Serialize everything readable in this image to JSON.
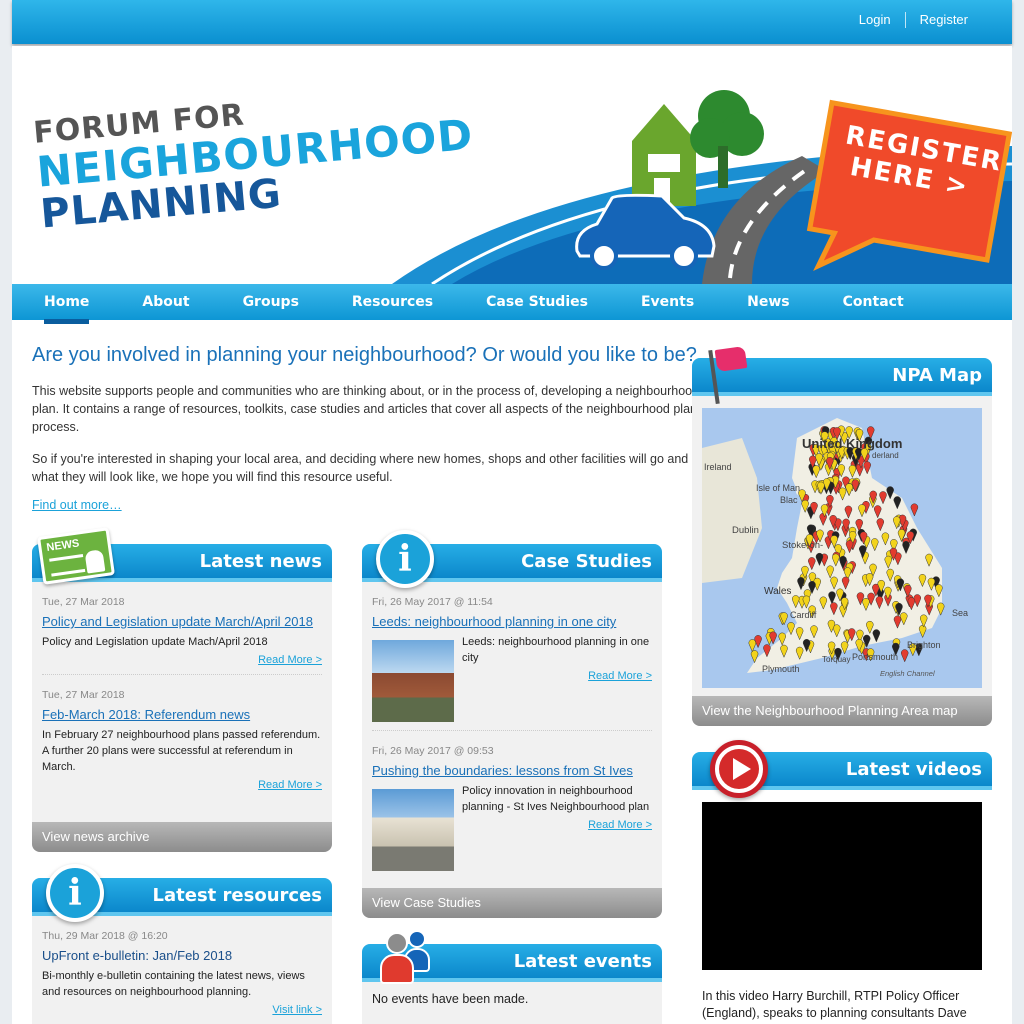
{
  "topbar": {
    "login": "Login",
    "register": "Register"
  },
  "logo": {
    "line1": "FORUM FOR",
    "line2": "NEIGHBOURHOOD",
    "line3": "PLANNING"
  },
  "banner": {
    "register_line1": "REGISTER",
    "register_line2": "HERE >"
  },
  "nav": [
    {
      "label": "Home"
    },
    {
      "label": "About"
    },
    {
      "label": "Groups"
    },
    {
      "label": "Resources"
    },
    {
      "label": "Case Studies"
    },
    {
      "label": "Events"
    },
    {
      "label": "News"
    },
    {
      "label": "Contact"
    }
  ],
  "intro": {
    "title": "Are you involved in planning your neighbourhood? Or would you like to be?",
    "p1": "This website supports people and communities who are thinking about, or in the process of, developing a neighbourhood plan. It contains a range of resources, toolkits, case studies and articles that cover all aspects of the neighbourhood plan process.",
    "p2": "So if you're interested in shaping your local area, and deciding where new homes, shops and other facilities will go and what they will look like, we hope you will find this resource useful.",
    "find_more": "Find out more…"
  },
  "news": {
    "title": "Latest news",
    "badge": "NEWS",
    "items": [
      {
        "date": "Tue, 27 Mar 2018",
        "title": "Policy and Legislation update March/April 2018 ",
        "body": "Policy and Legislation update Mach/April 2018",
        "more": "Read More >"
      },
      {
        "date": "Tue, 27 Mar 2018",
        "title": "Feb-March 2018: Referendum news",
        "body": "In February 27 neighbourhood plans passed referendum. A further 20 plans were successful at referendum in March.",
        "more": "Read More >"
      }
    ],
    "footer": "View news archive"
  },
  "cases": {
    "title": "Case Studies",
    "items": [
      {
        "date": "Fri, 26 May 2017 @ 11:54",
        "title": "Leeds: neighbourhood planning in one city ",
        "body": "Leeds: neighbourhood planning in one city",
        "more": "Read More >"
      },
      {
        "date": "Fri, 26 May 2017 @ 09:53",
        "title": "Pushing the boundaries: lessons from St Ives",
        "body": "Policy innovation in neighbourhood planning - St Ives Neighbourhood plan",
        "more": "Read More >"
      }
    ],
    "footer": "View Case Studies"
  },
  "resources": {
    "title": "Latest resources",
    "items": [
      {
        "date": "Thu, 29 Mar 2018 @ 16:20",
        "title": "UpFront e-bulletin: Jan/Feb 2018",
        "body": "Bi-monthly e-bulletin containing the latest news, views and resources on neighbourhood planning.",
        "more": "Visit link >"
      }
    ]
  },
  "events": {
    "title": "Latest events",
    "empty": "No events have been made."
  },
  "map": {
    "title": "NPA Map",
    "labels": [
      "United Kingdom",
      "Isle of Man",
      "Dublin",
      "Wales",
      "Stoke-on-",
      "Cardiff",
      "Plymouth",
      "Portsmouth",
      "Brighton",
      "English Channel",
      "Ireland",
      "Sea",
      "derland",
      "Blac",
      "Torquay"
    ],
    "footer": "View the Neighbourhood Planning Area map"
  },
  "videos": {
    "title": "Latest videos",
    "text": "In this video Harry Burchill, RTPI Policy Officer (England), speaks to planning consultants Dave"
  },
  "colors": {
    "brand_blue": "#0d96d4",
    "dark_blue": "#16579a",
    "register_red": "#f04a2a",
    "link": "#1ba2d9"
  }
}
